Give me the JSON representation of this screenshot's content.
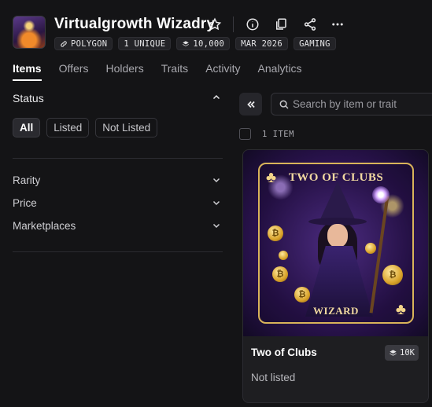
{
  "collection": {
    "title": "Virtualgrowth Wizadry",
    "badges": {
      "chain": "POLYGON",
      "unique": "1 UNIQUE",
      "supply": "10,000",
      "date": "MAR 2026",
      "category": "GAMING"
    }
  },
  "tabs": [
    "Items",
    "Offers",
    "Holders",
    "Traits",
    "Activity",
    "Analytics"
  ],
  "sidebar": {
    "status": {
      "label": "Status",
      "filters": [
        "All",
        "Listed",
        "Not Listed"
      ]
    },
    "facets": [
      "Rarity",
      "Price",
      "Marketplaces"
    ]
  },
  "search": {
    "placeholder": "Search by item or trait"
  },
  "results": {
    "count": "1 ITEM"
  },
  "item": {
    "art_title": "TWO OF CLUBS",
    "art_footer": "WIZARD",
    "name": "Two of Clubs",
    "quantity": "10K",
    "status": "Not listed"
  },
  "colors": {
    "background": "#141416",
    "card": "#1e1e21",
    "gold": "#d9b45a",
    "purple": "#6a3fb0"
  }
}
